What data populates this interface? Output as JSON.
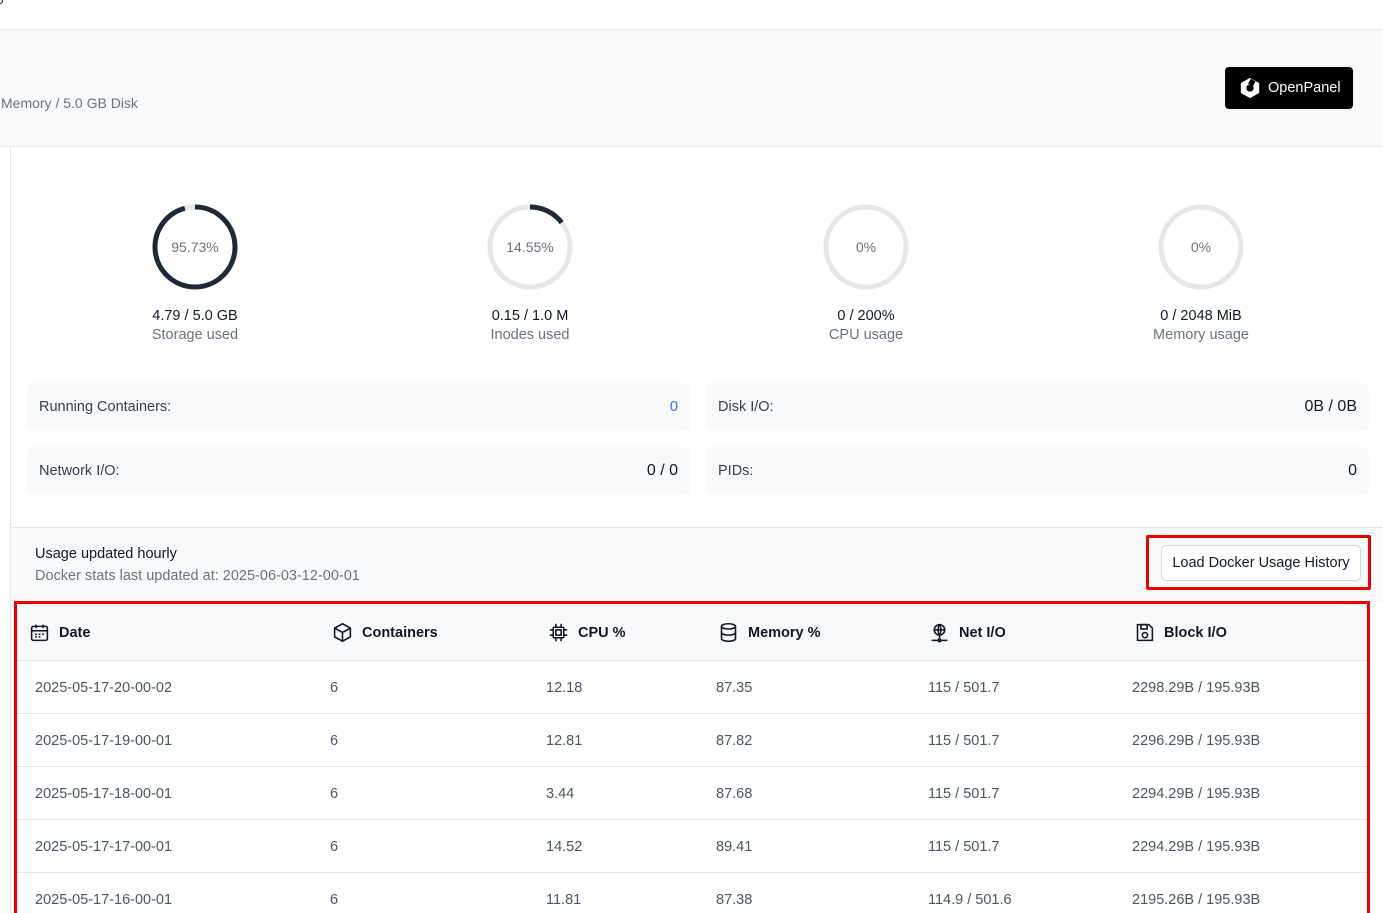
{
  "topbar": {
    "fragment": "o"
  },
  "header": {
    "subtitle": "Memory / 5.0 GB Disk",
    "brand": "OpenPanel"
  },
  "gauges": [
    {
      "percent_label": "95.73%",
      "value": "4.79 / 5.0 GB",
      "label": "Storage used",
      "fraction": 0.9573
    },
    {
      "percent_label": "14.55%",
      "value": "0.15 / 1.0 M",
      "label": "Inodes used",
      "fraction": 0.1455
    },
    {
      "percent_label": "0%",
      "value": "0 / 200%",
      "label": "CPU usage",
      "fraction": 0
    },
    {
      "percent_label": "0%",
      "value": "0 / 2048 MiB",
      "label": "Memory usage",
      "fraction": 0
    }
  ],
  "stats": {
    "running_containers": {
      "label": "Running Containers:",
      "value": "0"
    },
    "disk_io": {
      "label": "Disk I/O:",
      "value": "0B / 0B"
    },
    "network_io": {
      "label": "Network I/O:",
      "value": "0 / 0"
    },
    "pids": {
      "label": "PIDs:",
      "value": "0"
    }
  },
  "usage": {
    "title": "Usage updated hourly",
    "updated": "Docker stats last updated at: 2025-06-03-12-00-01",
    "load_button": "Load Docker Usage History"
  },
  "table": {
    "headers": {
      "date": "Date",
      "containers": "Containers",
      "cpu": "CPU %",
      "memory": "Memory %",
      "net": "Net I/O",
      "block": "Block I/O"
    },
    "rows": [
      [
        "2025-05-17-20-00-02",
        "6",
        "12.18",
        "87.35",
        "115 / 501.7",
        "2298.29B / 195.93B"
      ],
      [
        "2025-05-17-19-00-01",
        "6",
        "12.81",
        "87.82",
        "115 / 501.7",
        "2296.29B / 195.93B"
      ],
      [
        "2025-05-17-18-00-01",
        "6",
        "3.44",
        "87.68",
        "115 / 501.7",
        "2294.29B / 195.93B"
      ],
      [
        "2025-05-17-17-00-01",
        "6",
        "14.52",
        "89.41",
        "115 / 501.7",
        "2294.29B / 195.93B"
      ],
      [
        "2025-05-17-16-00-01",
        "6",
        "11.81",
        "87.38",
        "114.9 / 501.6",
        "2195.26B / 195.93B"
      ]
    ]
  },
  "colors": {
    "gauge_track": "#e5e7eb",
    "gauge_fill": "#1f2937",
    "gauge_alert": "#e05a6a",
    "highlight": "#ee0000",
    "link_blue": "#2f6ee5"
  }
}
